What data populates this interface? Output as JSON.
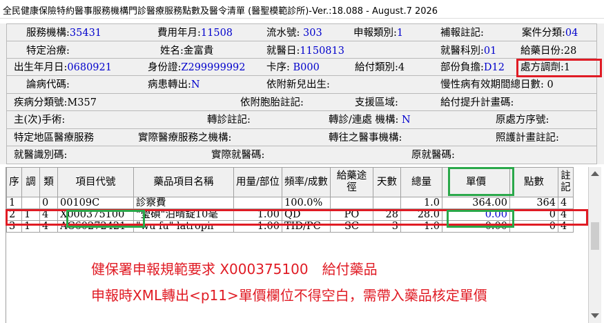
{
  "window": {
    "title": "全民健康保險特約醫事服務機構門診醫療服務點數及醫令清單 (醫聖模範診所)-Ver.:18.088 - August.7 2026"
  },
  "form": {
    "r1": [
      {
        "label": "服務機構:",
        "value": "35431"
      },
      {
        "label": "費用年月:",
        "value": "11508"
      },
      {
        "label": "流水號:",
        "value": "303"
      },
      {
        "label": "申報類別:",
        "value": "1"
      },
      {
        "label": "補報註記:",
        "value": ""
      },
      {
        "label": "案件分類:",
        "value": "04"
      }
    ],
    "r2": [
      {
        "label": "特定治療:",
        "value": ""
      },
      {
        "label": "姓名:",
        "value": "金富貴"
      },
      {
        "label": "就醫日:",
        "value": "1150813"
      },
      {
        "label": "就醫科別:",
        "value": "01"
      },
      {
        "label": "給藥日份:",
        "value": "28"
      }
    ],
    "r3": [
      {
        "label": "出生年月日:",
        "value": "0680921"
      },
      {
        "label": "身份證:",
        "value": "Z299999992"
      },
      {
        "label": "卡序:",
        "value": "B000"
      },
      {
        "label": "給付類別:",
        "value": "4"
      },
      {
        "label": "部份負擔:",
        "value": "D12"
      },
      {
        "label": "處方調劑:",
        "value": "1"
      }
    ],
    "r4": [
      {
        "label": "論病代碼:",
        "value": ""
      },
      {
        "label": "病患轉出:",
        "value": "N"
      },
      {
        "label": "依附新兒出生:",
        "value": ""
      },
      {
        "label": "慢性病有效期間總日數:",
        "value": "0"
      }
    ],
    "r5": [
      {
        "label": "疾病分類號:",
        "value": "M357"
      },
      {
        "label": "依附胞胎註記:",
        "value": ""
      },
      {
        "label": "支援區域:",
        "value": ""
      },
      {
        "label": "給付提升計畫碼:",
        "value": ""
      }
    ],
    "r6": [
      {
        "label": "主(次)手術:",
        "value": ""
      },
      {
        "label": "轉診註記:",
        "value": ""
      },
      {
        "label": "轉診/連處 機構:",
        "value": "N"
      },
      {
        "label": "原處方序號:",
        "value": ""
      }
    ],
    "r7": [
      {
        "label": "特定地區醫療服務",
        "value": ""
      },
      {
        "label": "實際醫療服務之機構:",
        "value": ""
      },
      {
        "label": "轉往之醫事機構:",
        "value": ""
      },
      {
        "label": "照護計畫註記:",
        "value": ""
      }
    ],
    "r8": [
      {
        "label": "就醫識別碼:",
        "value": ""
      },
      {
        "label": "實際就醫碼:",
        "value": ""
      },
      {
        "label": "原就醫碼:",
        "value": ""
      }
    ]
  },
  "grid": {
    "headers": [
      "序",
      "調",
      "類",
      "項目代號",
      "藥品項目名稱",
      "用量/部位",
      "頻率/成數",
      "給藥途徑",
      "天數",
      "總量",
      "單價",
      "點數",
      "註記"
    ],
    "rows": [
      [
        "1",
        "",
        "0",
        "00109C",
        "診察費",
        "",
        "100.0%",
        "",
        "",
        "1.0",
        "364.00",
        "364",
        "4"
      ],
      [
        "2",
        "1",
        "4",
        "X000375100",
        "\"瑩碩\"泊晴錠10毫",
        "1.00",
        "QD",
        "PO",
        "28",
        "28.0",
        "0.00",
        "0",
        "4"
      ],
      [
        "3",
        "1",
        "4",
        "AC60272421",
        "\"wu fu\" latropir",
        "1.00",
        "TID/PC",
        "SC",
        "3",
        "1.0",
        "0.00",
        "0",
        "4"
      ]
    ]
  },
  "notes": {
    "line1": "健保署申報規範要求 X000375100　給付藥品",
    "line2": "申報時XML轉出<p11>單價欄位不得空白，需帶入藥品核定單價"
  },
  "colors": {
    "annotation_red": "#e01b24",
    "annotation_green": "#2aa84a",
    "value_blue": "#0000cc"
  }
}
